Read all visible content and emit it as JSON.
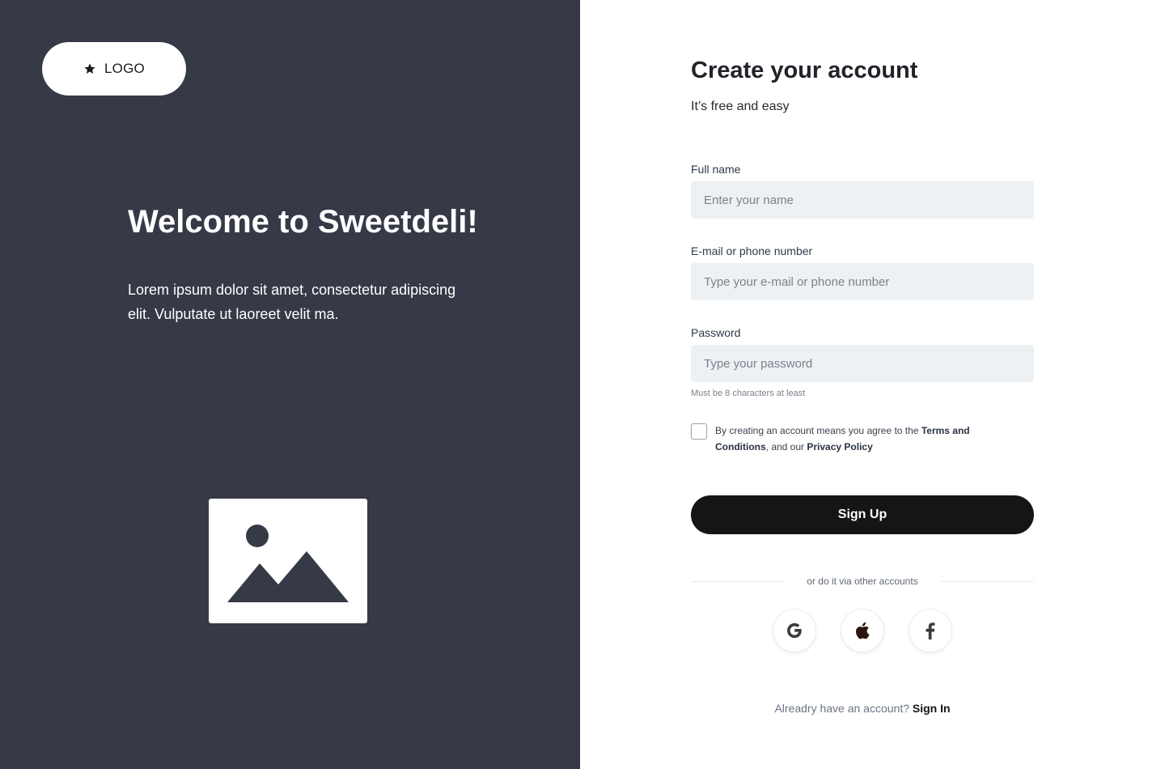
{
  "brand": {
    "logo_label": "LOGO",
    "panel_color": "#363946"
  },
  "hero": {
    "title": "Welcome to Sweetdeli!",
    "text": "Lorem ipsum dolor sit amet, consectetur adipiscing elit. Vulputate ut laoreet velit ma."
  },
  "form": {
    "title": "Create your account",
    "subtitle": "It’s free and easy",
    "fields": [
      {
        "label": "Full name",
        "placeholder": "Enter your name",
        "value": ""
      },
      {
        "label": "E-mail or phone number",
        "placeholder": "Type your e-mail or phone number",
        "value": ""
      },
      {
        "label": "Password",
        "placeholder": "Type your password",
        "value": ""
      }
    ],
    "password_hint": "Must be 8 characters at least",
    "terms": {
      "prefix": "By creating an account means you agree to the ",
      "terms_link": "Terms and Conditions",
      "middle": ", and our ",
      "privacy_link": "Privacy Policy",
      "checked": false
    },
    "submit_label": "Sign Up",
    "divider_text": "or do it via other accounts",
    "social": [
      "google-icon",
      "apple-icon",
      "facebook-icon"
    ],
    "signin_question": "Alreadry have an account?",
    "signin_link": "Sign In"
  },
  "colors": {
    "accent": "#141517",
    "input_bg": "#edf1f4"
  }
}
